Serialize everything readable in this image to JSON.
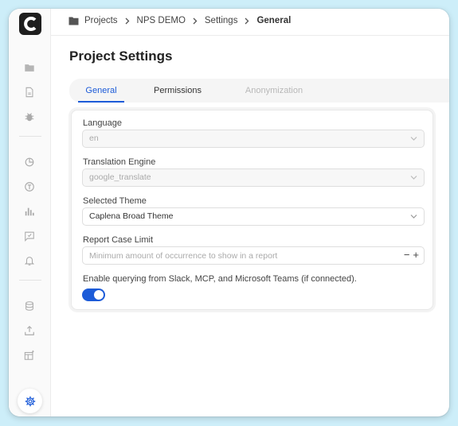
{
  "breadcrumb": {
    "items": [
      "Projects",
      "NPS DEMO",
      "Settings"
    ],
    "current": "General"
  },
  "page": {
    "title": "Project Settings"
  },
  "tabs": [
    {
      "label": "General",
      "state": "active"
    },
    {
      "label": "Permissions",
      "state": "normal"
    },
    {
      "label": "Anonymization",
      "state": "disabled"
    }
  ],
  "form": {
    "language": {
      "label": "Language",
      "value": "en"
    },
    "translation_engine": {
      "label": "Translation Engine",
      "value": "google_translate"
    },
    "theme": {
      "label": "Selected Theme",
      "value": "Caplena Broad Theme"
    },
    "report_case_limit": {
      "label": "Report Case Limit",
      "value": "",
      "placeholder": "Minimum amount of occurrence to show in a report",
      "minus": "−",
      "plus": "+"
    },
    "querying": {
      "label": "Enable querying from Slack, MCP, and Microsoft Teams (if connected).",
      "enabled": true
    }
  },
  "sidebar": {
    "logo": "C",
    "icons": [
      "folder-icon",
      "document-icon",
      "bug-icon",
      "pie-chart-icon",
      "topic-icon",
      "bar-chart-icon",
      "feedback-icon",
      "bell-icon",
      "database-icon",
      "upload-icon",
      "new-feature-icon",
      "gear-icon"
    ]
  },
  "colors": {
    "accent": "#1c5bd8",
    "background": "#cdeef9",
    "logo_bg": "#1e1e1e"
  }
}
